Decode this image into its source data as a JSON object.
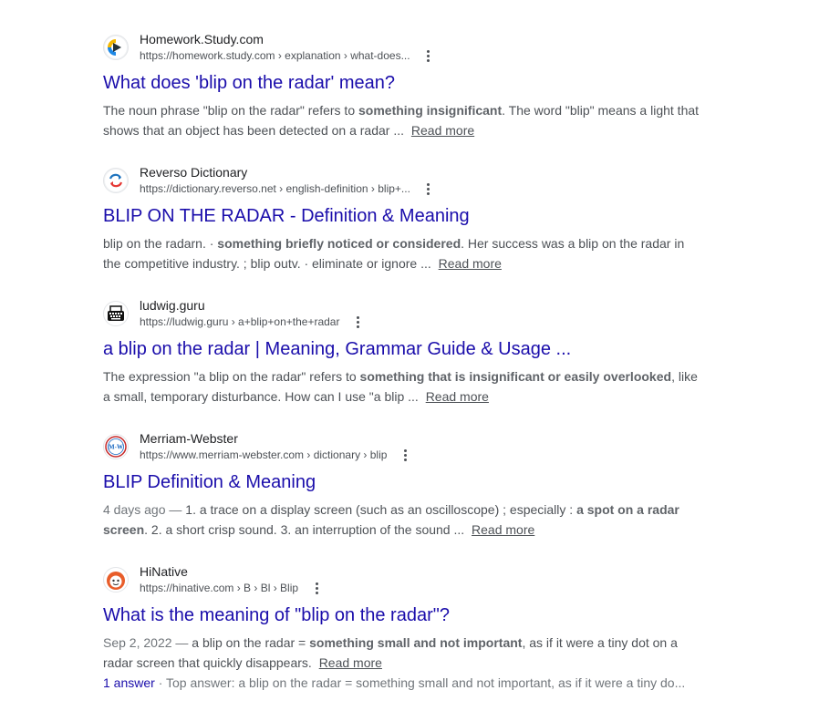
{
  "results": [
    {
      "site": "Homework.Study.com",
      "url": "https://homework.study.com › explanation › what-does...",
      "title": "What does 'blip on the radar' mean?",
      "snippet_pre": "The noun phrase \"blip on the radar\" refers to ",
      "snippet_bold": "something insignificant",
      "snippet_post": ". The word \"blip\" means a light that shows that an object has been detected on a radar ...",
      "read_more": "Read more",
      "icon": "study-com-play-icon"
    },
    {
      "site": "Reverso Dictionary",
      "url": "https://dictionary.reverso.net › english-definition › blip+...",
      "title": "BLIP ON THE RADAR - Definition & Meaning",
      "snippet_pre": "blip on the radarn. · ",
      "snippet_bold": "something briefly noticed or considered",
      "snippet_post": ". Her success was a blip on the radar in the competitive industry. ; blip outv. · eliminate or ignore ...",
      "read_more": "Read more",
      "icon": "reverso-arrows-icon"
    },
    {
      "site": "ludwig.guru",
      "url": "https://ludwig.guru › a+blip+on+the+radar",
      "title": "a blip on the radar | Meaning, Grammar Guide & Usage ...",
      "snippet_pre": "The expression \"a blip on the radar\" refers to ",
      "snippet_bold": "something that is insignificant or easily overlooked",
      "snippet_post": ", like a small, temporary disturbance. How can I use \"a blip ...",
      "read_more": "Read more",
      "icon": "typewriter-icon"
    },
    {
      "site": "Merriam-Webster",
      "url": "https://www.merriam-webster.com › dictionary › blip",
      "title": "BLIP Definition & Meaning",
      "date": "4 days ago — ",
      "snippet_pre": "1. a trace on a display screen (such as an oscilloscope) ; especially : ",
      "snippet_bold": "a spot on a radar screen",
      "snippet_post": ". 2. a short crisp sound. 3. an interruption of the sound ...",
      "read_more": "Read more",
      "icon": "merriam-webster-mw-icon",
      "icon_text": "M-W"
    },
    {
      "site": "HiNative",
      "url": "https://hinative.com › B › Bl › Blip",
      "title": "What is the meaning of \"blip on the radar\"?",
      "date": "Sep 2, 2022 — ",
      "snippet_pre": "a blip on the radar = ",
      "snippet_bold": "something small and not important",
      "snippet_post": ", as if it were a tiny dot on a radar screen that quickly disappears.",
      "read_more": "Read more",
      "icon": "hinative-face-icon",
      "answers_link": "1 answer",
      "answers_text": " · Top answer: a blip on the radar = something small and not important, as if it were a tiny do..."
    }
  ],
  "colors": {
    "title_link": "#1a0dab",
    "text": "#4d5156",
    "site_name": "#202124"
  }
}
